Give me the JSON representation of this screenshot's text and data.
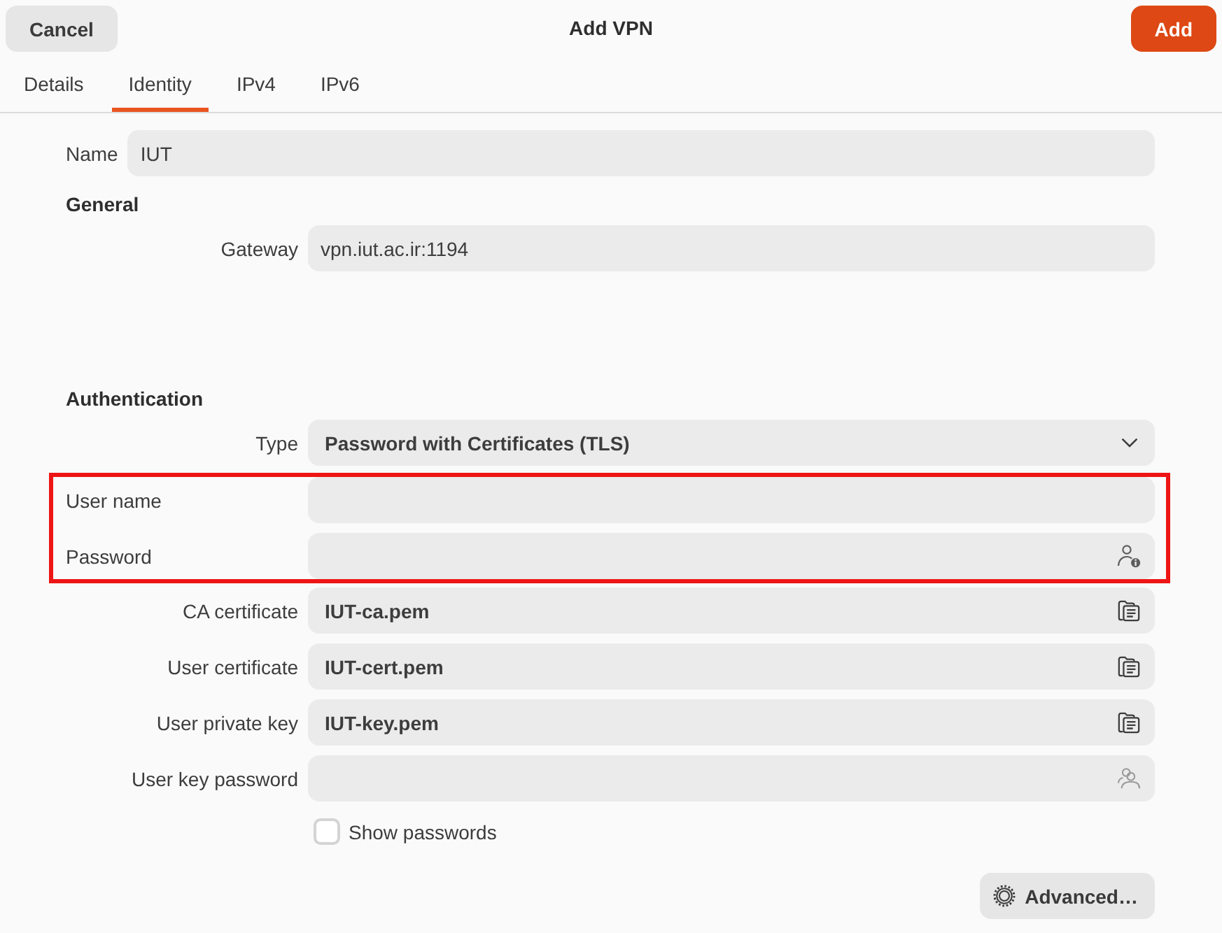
{
  "window": {
    "title": "Add VPN"
  },
  "header": {
    "buttons": [
      {
        "label": "Cancel",
        "kind": "plain"
      },
      {
        "label": "Add",
        "kind": "suggested"
      }
    ]
  },
  "tabs": [
    {
      "label": "Details",
      "selected": false
    },
    {
      "label": "Identity",
      "selected": true
    },
    {
      "label": "IPv4",
      "selected": false
    },
    {
      "label": "IPv6",
      "selected": false
    }
  ],
  "name_field": {
    "label": "Name",
    "value": "IUT"
  },
  "sections": [
    {
      "heading": "General",
      "rows": [
        {
          "kind": "entry",
          "label": "Gateway",
          "value": "vpn.iut.ac.ir:1194",
          "highlighted": false
        }
      ]
    },
    {
      "heading": "Authentication",
      "rows": [
        {
          "kind": "dropdown",
          "label": "Type",
          "value": "Password with Certificates (TLS)",
          "highlighted": false
        },
        {
          "kind": "entry",
          "label": "User name",
          "highlighted": true
        },
        {
          "kind": "password",
          "label": "Password",
          "highlighted": true
        },
        {
          "kind": "file",
          "label": "CA certificate",
          "value": "IUT-ca.pem",
          "highlighted": false
        },
        {
          "kind": "file",
          "label": "User certificate",
          "value": "IUT-cert.pem",
          "highlighted": false
        },
        {
          "kind": "file",
          "label": "User private key",
          "value": "IUT-key.pem",
          "highlighted": false
        },
        {
          "kind": "passphrase",
          "label": "User key password",
          "highlighted": false
        }
      ]
    }
  ],
  "show_passwords": {
    "label": "Show passwords",
    "checked": false
  },
  "advanced_button": {
    "label": "Advanced…"
  }
}
